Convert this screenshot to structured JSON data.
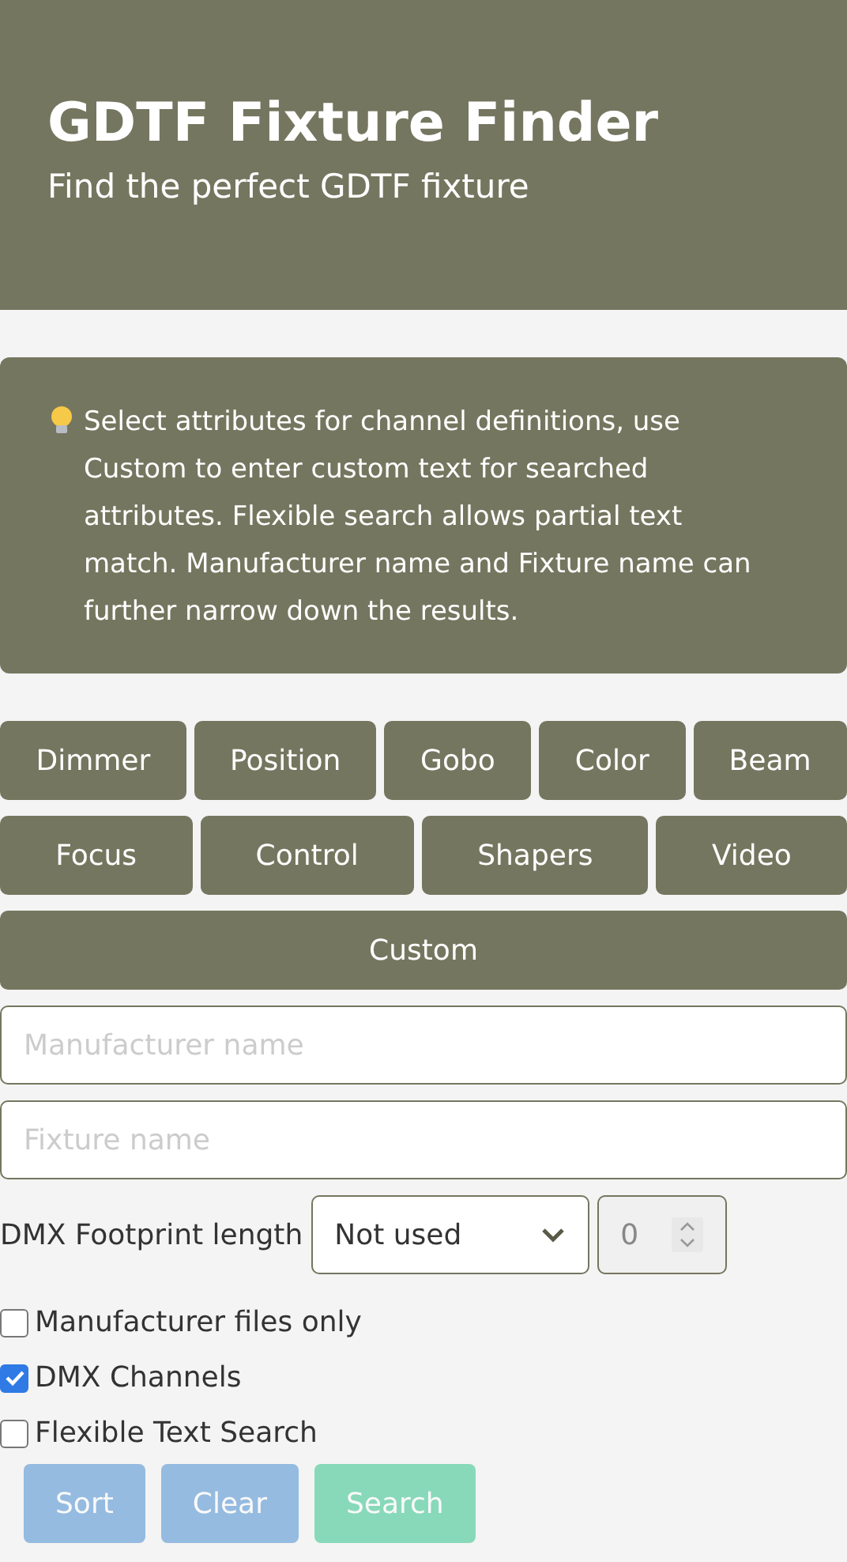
{
  "header": {
    "title": "GDTF Fixture Finder",
    "subtitle": "Find the perfect GDTF fixture"
  },
  "info": {
    "text": "Select attributes for channel definitions, use Custom to enter custom text for searched attributes. Flexible search allows partial text match. Manufacturer name and Fixture name can further narrow down the results."
  },
  "attribute_rows": [
    [
      {
        "label": "Dimmer",
        "selected": false
      },
      {
        "label": "Position",
        "selected": false
      },
      {
        "label": "Gobo",
        "selected": false
      },
      {
        "label": "Color",
        "selected": false
      },
      {
        "label": "Beam",
        "selected": false
      }
    ],
    [
      {
        "label": "Focus",
        "selected": false
      },
      {
        "label": "Control",
        "selected": false
      },
      {
        "label": "Shapers",
        "selected": false
      },
      {
        "label": "Video",
        "selected": false
      }
    ],
    [
      {
        "label": "Custom",
        "selected": false
      }
    ]
  ],
  "manufacturer_field": {
    "placeholder": "Manufacturer name"
  },
  "fixture_field": {
    "placeholder": "Fixture name"
  },
  "footprint": {
    "label": "DMX Footprint length",
    "select_value": "Not used",
    "number_value": "0",
    "number_disabled": true
  },
  "checkboxes": [
    {
      "label": "Manufacturer files only",
      "checked": false
    },
    {
      "label": "DMX Channels",
      "checked": true
    },
    {
      "label": "Flexible Text Search",
      "checked": false
    }
  ],
  "actions": [
    {
      "label": "Sort",
      "kind": "secondary",
      "disabled": true
    },
    {
      "label": "Clear",
      "kind": "secondary",
      "disabled": true
    },
    {
      "label": "Search",
      "kind": "primary",
      "disabled": true
    }
  ]
}
